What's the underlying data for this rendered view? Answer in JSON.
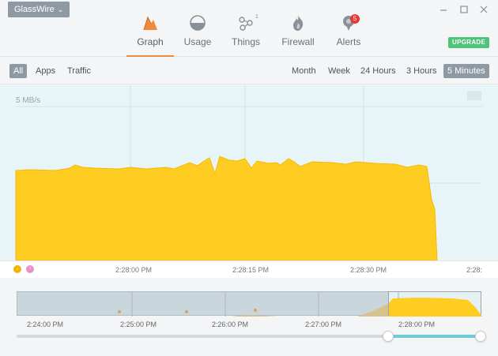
{
  "app": {
    "menu_label": "GlassWire"
  },
  "nav": {
    "tabs": [
      {
        "id": "graph",
        "label": "Graph",
        "active": true
      },
      {
        "id": "usage",
        "label": "Usage"
      },
      {
        "id": "things",
        "label": "Things",
        "sup": "1"
      },
      {
        "id": "firewall",
        "label": "Firewall"
      },
      {
        "id": "alerts",
        "label": "Alerts",
        "badge": "5"
      }
    ],
    "upgrade_label": "UPGRADE"
  },
  "filters": {
    "left": [
      {
        "label": "All",
        "selected": true
      },
      {
        "label": "Apps"
      },
      {
        "label": "Traffic"
      }
    ],
    "right": [
      {
        "label": "Month"
      },
      {
        "label": "Week"
      },
      {
        "label": "24 Hours"
      },
      {
        "label": "3 Hours"
      },
      {
        "label": "5 Minutes",
        "selected": true
      }
    ]
  },
  "graph": {
    "y_label": "5 MB/s",
    "x_ticks": [
      "2:28:00 PM",
      "2:28:15 PM",
      "2:28:30 PM",
      "2:28:"
    ],
    "fill_color": "#ffcc22",
    "stroke_color": "#f5b800"
  },
  "overview": {
    "ticks": [
      "2:24:00 PM",
      "2:25:00 PM",
      "2:26:00 PM",
      "2:27:00 PM",
      "2:28:00 PM"
    ]
  }
}
